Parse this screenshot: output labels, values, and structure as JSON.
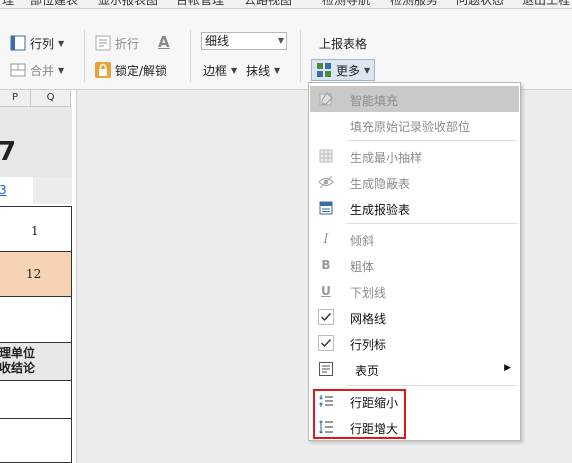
{
  "menubar": [
    "理",
    "部位建表",
    "显示报表图",
    "台帐管理",
    "公路视图",
    "检测导航",
    "检测服务",
    "问题状态",
    "退出工程"
  ],
  "ribbon": {
    "row_col": "行列",
    "merge": "合并",
    "wrap": "折行",
    "font_letter": "A",
    "lock": "锁定/解锁",
    "line_combo_value": "细线",
    "border": "边框",
    "erase_line": "抹线",
    "report_table": "上报表格",
    "more": "更多"
  },
  "sheet": {
    "col_headers": [
      "P",
      "Q"
    ],
    "title_fragment": "7",
    "link_fragment": "3",
    "cell_value_1": "1",
    "cell_value_2": "12",
    "header_line1": "理单位",
    "header_line2": "收结论"
  },
  "dropdown": {
    "items": [
      {
        "label": "智能填充",
        "icon": "fill-icon",
        "state": "disabled-highlight"
      },
      {
        "label": "填充原始记录验收部位",
        "icon": "",
        "state": "disabled"
      },
      {
        "label": "生成最小抽样",
        "icon": "grid-icon",
        "state": "disabled"
      },
      {
        "label": "生成隐蔽表",
        "icon": "eye-icon",
        "state": "disabled"
      },
      {
        "label": "生成报验表",
        "icon": "form-icon",
        "state": "enabled"
      },
      {
        "label": "倾斜",
        "icon": "italic-icon",
        "state": "disabled"
      },
      {
        "label": "粗体",
        "icon": "bold-icon",
        "state": "disabled"
      },
      {
        "label": "下划线",
        "icon": "underline-icon",
        "state": "disabled"
      },
      {
        "label": "网格线",
        "icon": "check-icon",
        "state": "checked"
      },
      {
        "label": "行列标",
        "icon": "check-icon",
        "state": "checked"
      },
      {
        "label": "表页",
        "icon": "page-icon",
        "state": "submenu"
      },
      {
        "label": "行距缩小",
        "icon": "line-spacing-decrease-icon",
        "state": "enabled"
      },
      {
        "label": "行距增大",
        "icon": "line-spacing-increase-icon",
        "state": "enabled"
      }
    ]
  },
  "colors": {
    "highlight": "#e01818",
    "peach_cell": "#f6d3b4",
    "menu_highlight": "#c9c9c9"
  }
}
